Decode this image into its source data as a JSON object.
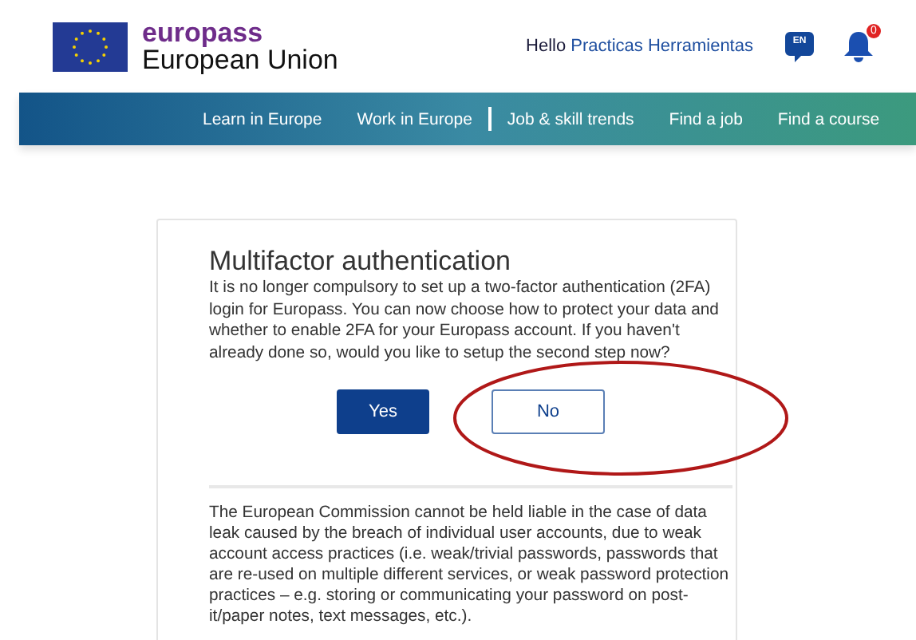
{
  "header": {
    "brand": "europass",
    "subtitle": "European Union",
    "greeting": "Hello",
    "user": "Practicas Herramientas",
    "language": "EN",
    "notifications": "0"
  },
  "nav": [
    {
      "label": "Learn in Europe",
      "divider_after": false
    },
    {
      "label": "Work in Europe",
      "divider_after": true
    },
    {
      "label": "Job & skill trends",
      "divider_after": false
    },
    {
      "label": "Find a job",
      "divider_after": false
    },
    {
      "label": "Find a course",
      "divider_after": false
    }
  ],
  "dialog": {
    "title": "Multifactor authentication",
    "message": "It is no longer compulsory to set up a two-factor authentication (2FA) login for Europass.  You can now choose how to protect your data and whether to enable 2FA for your Europass account. If you haven't already done so, would you like to setup the second step now?",
    "buttons": [
      {
        "label": "Yes",
        "kind": "primary"
      },
      {
        "label": "No",
        "kind": "secondary"
      }
    ],
    "disclaimer": "The European Commission cannot be held liable in the case of data leak caused by the breach of individual user accounts, due to weak account access practices (i.e. weak/trivial passwords, passwords that are re-used on multiple different services, or weak password protection practices – e.g. storing or communicating your password on post-it/paper notes, text messages, etc.)."
  }
}
